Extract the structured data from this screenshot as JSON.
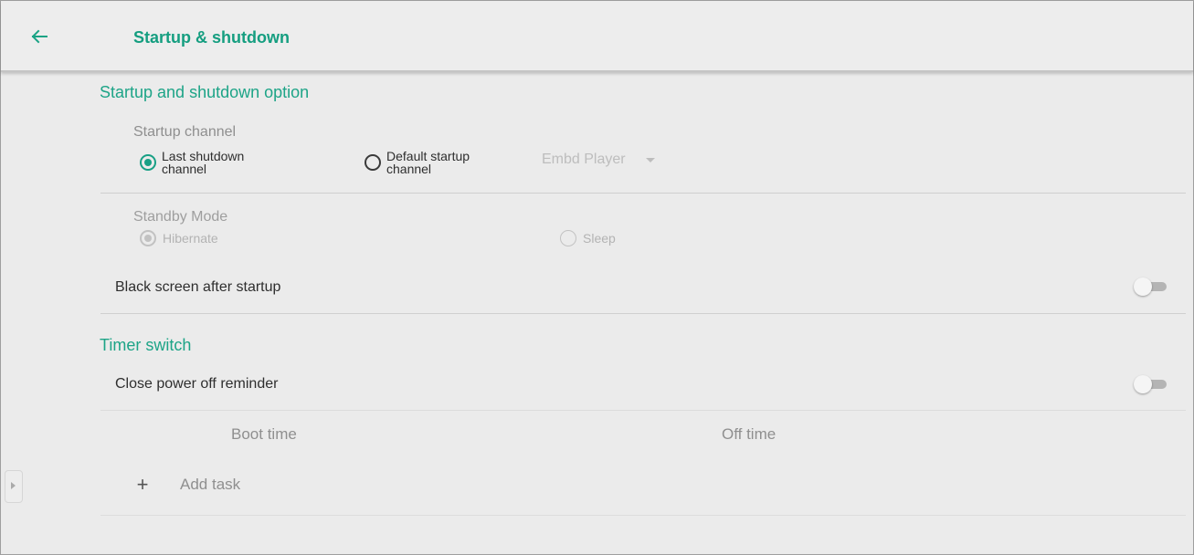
{
  "header": {
    "title": "Startup & shutdown",
    "back_icon": "arrow-back-icon"
  },
  "startup_section": {
    "title": "Startup and shutdown option",
    "startup_channel": {
      "label": "Startup channel",
      "options": [
        {
          "label": "Last shutdown channel",
          "selected": true
        },
        {
          "label": "Default startup channel",
          "selected": false
        }
      ],
      "dropdown_value": "Embd Player"
    },
    "standby_mode": {
      "label": "Standby Mode",
      "options": [
        {
          "label": "Hibernate",
          "selected": true,
          "disabled": true
        },
        {
          "label": "Sleep",
          "selected": false,
          "disabled": true
        }
      ]
    },
    "black_screen": {
      "label": "Black screen after startup",
      "enabled": false
    }
  },
  "timer_section": {
    "title": "Timer switch",
    "close_reminder": {
      "label": "Close power off reminder",
      "enabled": false
    },
    "columns": {
      "boot": "Boot time",
      "off": "Off time"
    },
    "add_task": "Add task"
  },
  "colors": {
    "accent": "#18a085",
    "background": "#ebebeb",
    "disabled": "#b3b3b3"
  }
}
